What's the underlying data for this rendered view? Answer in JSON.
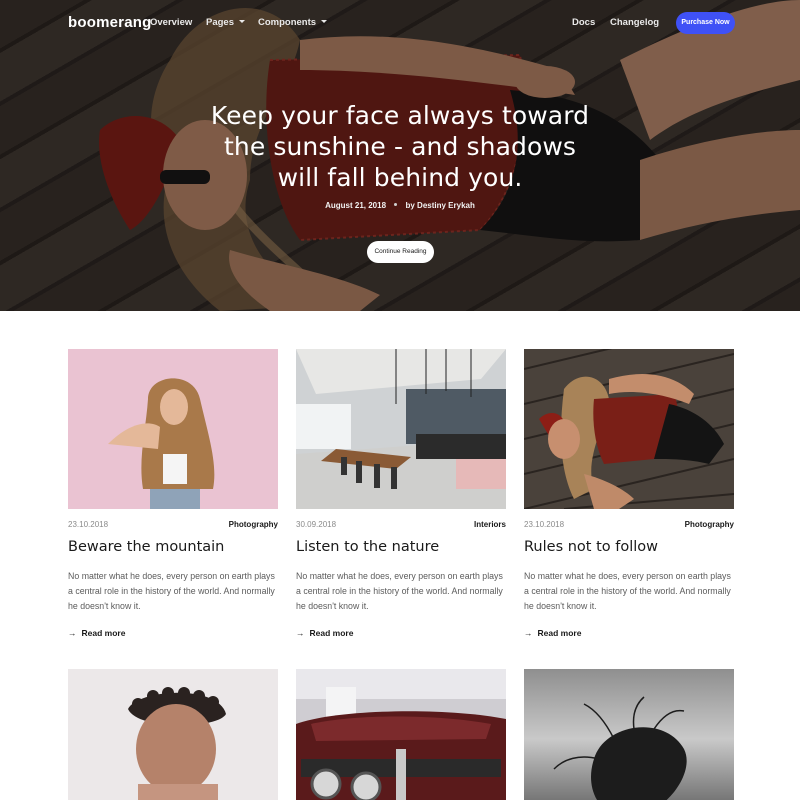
{
  "brand": {
    "logo": "boomerang",
    "accent_color": "#3f51f6"
  },
  "nav": {
    "left": [
      {
        "label": "Overview",
        "dropdown": false
      },
      {
        "label": "Pages",
        "dropdown": true
      },
      {
        "label": "Components",
        "dropdown": true
      }
    ],
    "right": [
      {
        "label": "Docs"
      },
      {
        "label": "Changelog"
      }
    ],
    "cta": "Purchase Now"
  },
  "hero": {
    "title_lines": [
      "Keep your face always toward",
      "the sunshine - and shadows",
      "will fall behind you."
    ],
    "date": "August 21, 2018",
    "author": "by Destiny Erykah",
    "button": "Continue Reading"
  },
  "posts": [
    {
      "date": "23.10.2018",
      "category": "Photography",
      "title": "Beware the mountain",
      "excerpt": "No matter what he does, every person on earth plays a central role in the history of the world. And normally he doesn't know it.",
      "read_more": "Read more",
      "arrow": "→"
    },
    {
      "date": "30.09.2018",
      "category": "Interiors",
      "title": "Listen to the nature",
      "excerpt": "No matter what he does, every person on earth plays a central role in the history of the world. And normally he doesn't know it.",
      "read_more": "Read more",
      "arrow": "→"
    },
    {
      "date": "23.10.2018",
      "category": "Photography",
      "title": "Rules not to follow",
      "excerpt": "No matter what he does, every person on earth plays a central role in the history of the world. And normally he doesn't know it.",
      "read_more": "Read more",
      "arrow": "→"
    }
  ]
}
